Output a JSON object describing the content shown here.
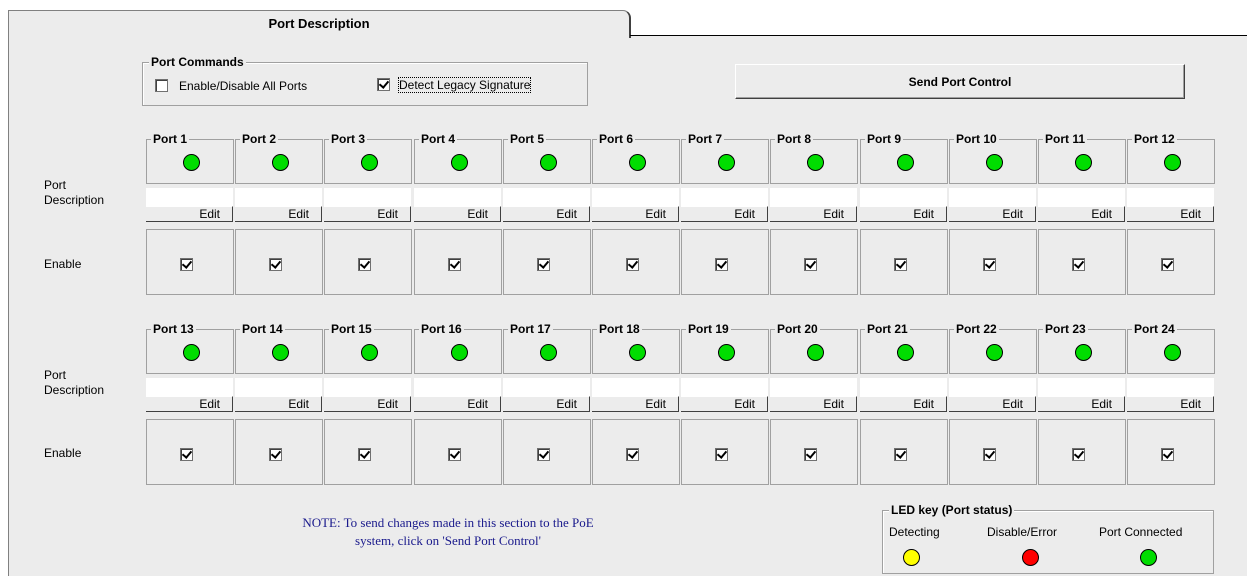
{
  "tab": {
    "label": "Port Description"
  },
  "port_commands": {
    "title": "Port Commands",
    "enable_disable_all": {
      "label": "Enable/Disable All Ports",
      "checked": false
    },
    "detect_legacy": {
      "label": "Detect Legacy Signature",
      "checked": true
    }
  },
  "send_button": {
    "label": "Send Port Control"
  },
  "row_labels": {
    "description_line1": "Port",
    "description_line2": "Description",
    "enable": "Enable"
  },
  "edit_label": "Edit",
  "port_rows": [
    {
      "ports": [
        {
          "name": "Port 1",
          "status": "connected",
          "enabled": true,
          "description": ""
        },
        {
          "name": "Port 2",
          "status": "connected",
          "enabled": true,
          "description": ""
        },
        {
          "name": "Port 3",
          "status": "connected",
          "enabled": true,
          "description": ""
        },
        {
          "name": "Port 4",
          "status": "connected",
          "enabled": true,
          "description": ""
        },
        {
          "name": "Port 5",
          "status": "connected",
          "enabled": true,
          "description": ""
        },
        {
          "name": "Port 6",
          "status": "connected",
          "enabled": true,
          "description": ""
        },
        {
          "name": "Port 7",
          "status": "connected",
          "enabled": true,
          "description": ""
        },
        {
          "name": "Port 8",
          "status": "connected",
          "enabled": true,
          "description": ""
        },
        {
          "name": "Port 9",
          "status": "connected",
          "enabled": true,
          "description": ""
        },
        {
          "name": "Port 10",
          "status": "connected",
          "enabled": true,
          "description": ""
        },
        {
          "name": "Port 11",
          "status": "connected",
          "enabled": true,
          "description": ""
        },
        {
          "name": "Port 12",
          "status": "connected",
          "enabled": true,
          "description": ""
        }
      ]
    },
    {
      "ports": [
        {
          "name": "Port 13",
          "status": "connected",
          "enabled": true,
          "description": ""
        },
        {
          "name": "Port 14",
          "status": "connected",
          "enabled": true,
          "description": ""
        },
        {
          "name": "Port 15",
          "status": "connected",
          "enabled": true,
          "description": ""
        },
        {
          "name": "Port 16",
          "status": "connected",
          "enabled": true,
          "description": ""
        },
        {
          "name": "Port 17",
          "status": "connected",
          "enabled": true,
          "description": ""
        },
        {
          "name": "Port 18",
          "status": "connected",
          "enabled": true,
          "description": ""
        },
        {
          "name": "Port 19",
          "status": "connected",
          "enabled": true,
          "description": ""
        },
        {
          "name": "Port 20",
          "status": "connected",
          "enabled": true,
          "description": ""
        },
        {
          "name": "Port 21",
          "status": "connected",
          "enabled": true,
          "description": ""
        },
        {
          "name": "Port 22",
          "status": "connected",
          "enabled": true,
          "description": ""
        },
        {
          "name": "Port 23",
          "status": "connected",
          "enabled": true,
          "description": ""
        },
        {
          "name": "Port 24",
          "status": "connected",
          "enabled": true,
          "description": ""
        }
      ]
    }
  ],
  "note": {
    "line1": "NOTE: To send changes made in this section to the PoE",
    "line2": "system, click on 'Send Port Control'"
  },
  "led_key": {
    "title": "LED key (Port status)",
    "items": [
      {
        "label": "Detecting",
        "color": "#ffff00"
      },
      {
        "label": "Disable/Error",
        "color": "#ff0000"
      },
      {
        "label": "Port Connected",
        "color": "#00dd00"
      }
    ]
  },
  "colors": {
    "connected": "#00dd00",
    "detecting": "#ffff00",
    "error": "#ff0000",
    "note_text": "#1a1a8c"
  }
}
